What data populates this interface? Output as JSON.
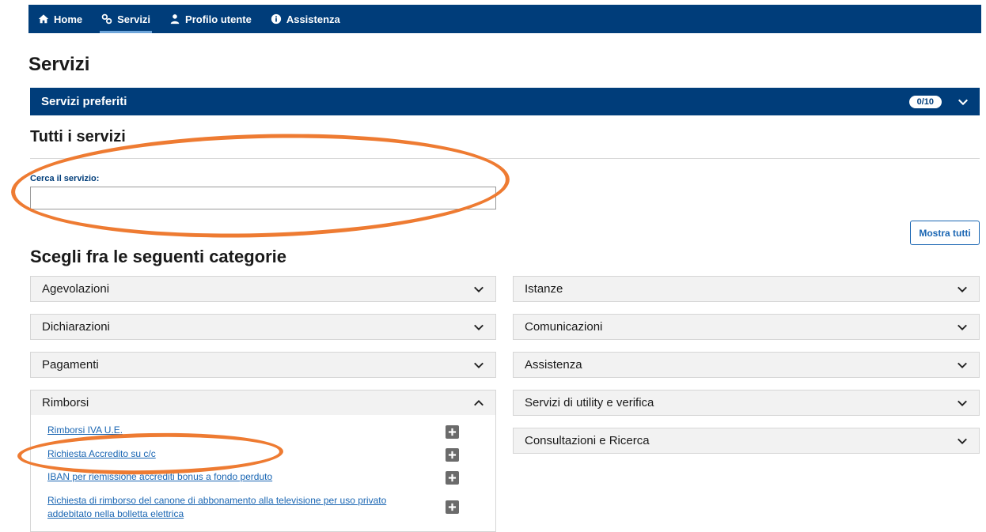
{
  "nav": {
    "items": [
      {
        "label": "Home",
        "icon": "home-icon"
      },
      {
        "label": "Servizi",
        "icon": "services-icon"
      },
      {
        "label": "Profilo utente",
        "icon": "user-icon"
      },
      {
        "label": "Assistenza",
        "icon": "info-icon"
      }
    ],
    "active": "Servizi"
  },
  "page": {
    "title": "Servizi"
  },
  "favorites": {
    "label": "Servizi preferiti",
    "count": "0/10"
  },
  "all_services": {
    "title": "Tutti i servizi",
    "search_label": "Cerca il servizio:",
    "search_value": "",
    "show_all": "Mostra tutti"
  },
  "categories": {
    "title": "Scegli fra le seguenti categorie",
    "left": [
      "Agevolazioni",
      "Dichiarazioni",
      "Pagamenti",
      "Rimborsi"
    ],
    "right": [
      "Istanze",
      "Comunicazioni",
      "Assistenza",
      "Servizi di utility e verifica",
      "Consultazioni e Ricerca"
    ],
    "expanded": "Rimborsi"
  },
  "rimborsi_items": [
    "Rimborsi IVA U.E.",
    "Richiesta Accredito su c/c",
    "IBAN per riemissione accrediti bonus a fondo perduto",
    "Richiesta di rimborso del canone di abbonamento alla televisione per uso privato addebitato nella bolletta elettrica"
  ],
  "colors": {
    "primary": "#003d7a",
    "link": "#1a66b3",
    "annotation": "#ee7b32"
  }
}
